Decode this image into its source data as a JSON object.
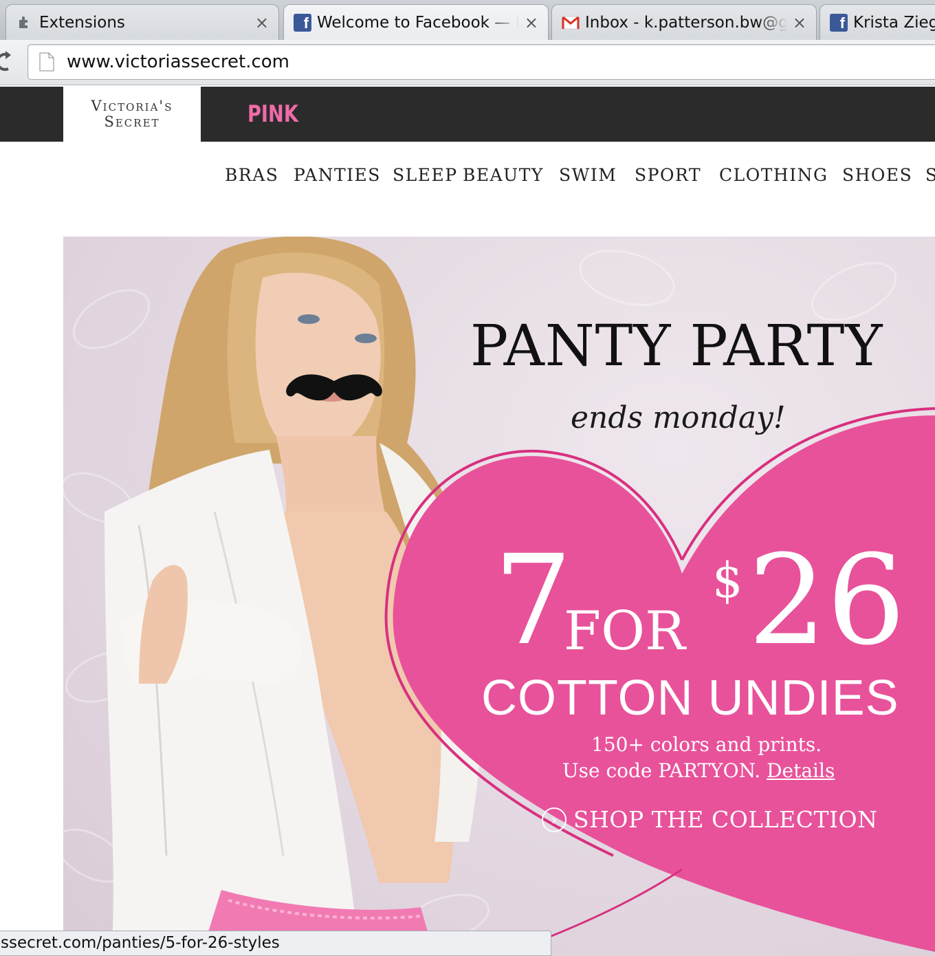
{
  "browser": {
    "tabs": [
      {
        "title": "Extensions",
        "icon": "puzzle-icon"
      },
      {
        "title": "Welcome to Facebook — Lo",
        "icon": "facebook-icon"
      },
      {
        "title": "Inbox - k.patterson.bw@gm",
        "icon": "gmail-icon"
      },
      {
        "title": "Krista Ziegl",
        "icon": "facebook-icon"
      }
    ],
    "close_glyph": "×",
    "url": "www.victoriassecret.com",
    "status_url": "ssecret.com/panties/5-for-26-styles"
  },
  "site": {
    "logo_line1": "Victoria's",
    "logo_line2": "Secret",
    "pink_label": "PINK",
    "nav": [
      "BRAS",
      "PANTIES",
      "SLEEP",
      "BEAUTY",
      "SWIM",
      "SPORT",
      "CLOTHING",
      "SHOES",
      "S"
    ]
  },
  "hero": {
    "title": "PANTY PARTY",
    "subtitle": "ends monday!",
    "deal_count": "7",
    "deal_for": "FOR",
    "deal_currency": "$",
    "deal_price": "26",
    "deal_product": "COTTON UNDIES",
    "line1": "150+ colors and prints.",
    "line2_prefix": "Use code PARTYON.",
    "details_link": "Details",
    "cta_glyph": "›",
    "cta": "SHOP THE COLLECTION"
  },
  "colors": {
    "heart": "#e8529a",
    "pink_brand": "#f06ba8",
    "header_dark": "#2b2b2b",
    "facebook_blue": "#3b5998",
    "gmail_red": "#d93025"
  }
}
